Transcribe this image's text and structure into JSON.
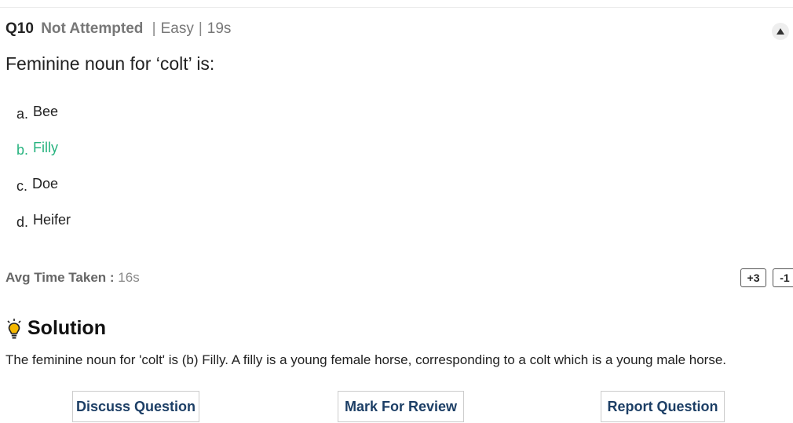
{
  "question": {
    "number": "Q10",
    "status": "Not Attempted",
    "difficulty": "Easy",
    "time": "19s",
    "separator": "|",
    "text": "Feminine noun for ‘colt’ is:",
    "options": [
      {
        "letter": "a.",
        "text": "Bee",
        "correct": false
      },
      {
        "letter": "b.",
        "text": "Filly",
        "correct": true
      },
      {
        "letter": "c.",
        "text": "Doe",
        "correct": false
      },
      {
        "letter": "d.",
        "text": "Heifer",
        "correct": false
      }
    ]
  },
  "avg_time": {
    "label": "Avg Time Taken :",
    "value": "16s"
  },
  "marks": {
    "positive": "+3",
    "negative": "-1"
  },
  "solution": {
    "title": "Solution",
    "text": "The feminine noun for 'colt' is (b) Filly. A filly is a young female horse, corresponding to a colt which is a young male horse."
  },
  "actions": {
    "discuss": "Discuss Question",
    "review": "Mark For Review",
    "report": "Report Question"
  },
  "colors": {
    "correct": "#27b37f",
    "button_text": "#1d3f66",
    "bulb": "#f5b800"
  }
}
